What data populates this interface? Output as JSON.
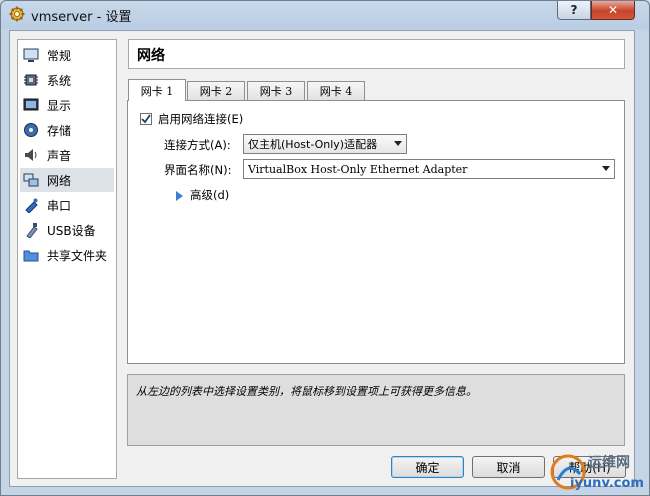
{
  "window": {
    "title": "vmserver - 设置",
    "help_label": "?",
    "close_label": "✕"
  },
  "sidebar": {
    "items": [
      {
        "label": "常规",
        "icon": "monitor-icon",
        "active": false
      },
      {
        "label": "系统",
        "icon": "chip-icon",
        "active": false
      },
      {
        "label": "显示",
        "icon": "display-icon",
        "active": false
      },
      {
        "label": "存储",
        "icon": "disk-icon",
        "active": false
      },
      {
        "label": "声音",
        "icon": "speaker-icon",
        "active": false
      },
      {
        "label": "网络",
        "icon": "network-icon",
        "active": true
      },
      {
        "label": "串口",
        "icon": "serial-port-icon",
        "active": false
      },
      {
        "label": "USB设备",
        "icon": "usb-icon",
        "active": false
      },
      {
        "label": "共享文件夹",
        "icon": "folder-icon",
        "active": false
      }
    ]
  },
  "header": {
    "title": "网络"
  },
  "tabs": [
    {
      "label": "网卡 1",
      "active": true
    },
    {
      "label": "网卡 2",
      "active": false
    },
    {
      "label": "网卡 3",
      "active": false
    },
    {
      "label": "网卡 4",
      "active": false
    }
  ],
  "adapter": {
    "enable_label": "启用网络连接(E)",
    "enabled": true,
    "attach_label": "连接方式(A):",
    "attach_value": "仅主机(Host-Only)适配器",
    "name_label": "界面名称(N):",
    "name_value": "VirtualBox Host-Only Ethernet Adapter",
    "advanced_label": "高级(d)"
  },
  "info": {
    "text": "从左边的列表中选择设置类别，将鼠标移到设置项上可获得更多信息。"
  },
  "buttons": {
    "ok": "确定",
    "cancel": "取消",
    "help": "帮助(H)"
  },
  "watermark": {
    "line1": "运维网",
    "line2": "iyunv.com"
  },
  "colors": {
    "accent": "#3b7fd4",
    "titlebar": "#b9cde4",
    "close": "#c7442a"
  }
}
